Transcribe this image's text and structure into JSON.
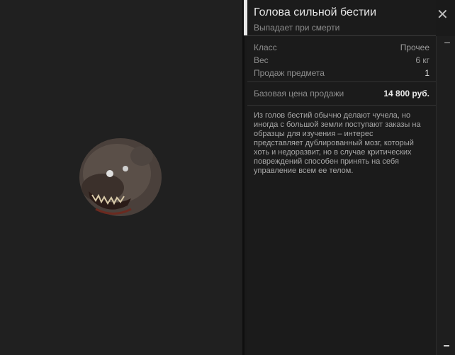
{
  "item": {
    "title": "Голова сильной бестии",
    "subtitle": "Выпадает при смерти",
    "stats": [
      {
        "label": "Класс",
        "value": "Прочее"
      },
      {
        "label": "Вес",
        "value": "6 кг"
      },
      {
        "label": "Продаж предмета",
        "value": "1"
      }
    ],
    "price": {
      "label": "Базовая цена продажи",
      "value": "14 800 руб."
    },
    "description": "Из голов бестий обычно делают чучела, но иногда с большой земли поступают заказы на образцы для изучения – интерес представляет дублированный мозг, который хоть и недоразвит, но в случае критических повреждений способен принять на себя управление всем ее телом."
  },
  "icons": {
    "close": "close-icon",
    "scroll": "minus-icon",
    "creature": "beast-head-image"
  },
  "colors": {
    "accent": "#e8e8e8",
    "panel_bg": "#1b1b1b"
  }
}
